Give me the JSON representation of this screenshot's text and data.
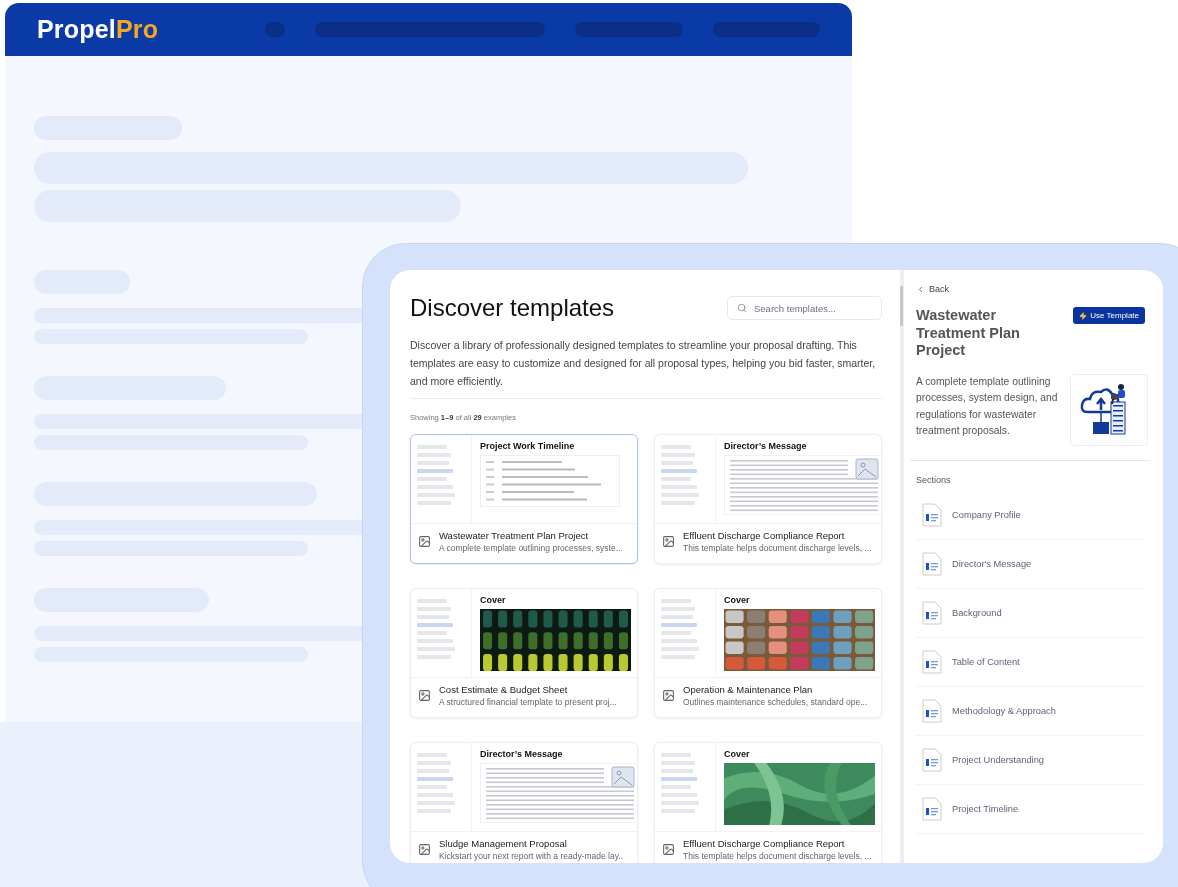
{
  "brand": {
    "first": "Propel",
    "second": "Pro"
  },
  "page": {
    "title": "Discover templates",
    "search": {
      "placeholder": "Search templates..."
    },
    "description": "Discover a library of professionally designed templates to streamline your proposal drafting. This templates are easy to customize and designed for all proposal types, helping you bid faster, smarter, and more efficiently.",
    "showing": "Showing **1–9** of all **29** examples"
  },
  "templates": [
    {
      "title": "Wastewater Treatment Plan Project",
      "description": "A complete template outlining processes, syste...",
      "selected": true,
      "preview": {
        "kind": "table",
        "heading": "Project Work Timeline"
      }
    },
    {
      "title": "Effluent Discharge Compliance Report",
      "description": "This template helps document discharge levels, ...",
      "selected": false,
      "preview": {
        "kind": "letter",
        "heading": "Director’s Message"
      }
    },
    {
      "title": "Cost Estimate & Budget Sheet",
      "description": "A structured financial template to present proj...",
      "selected": false,
      "preview": {
        "kind": "cover",
        "heading": "Cover"
      }
    },
    {
      "title": "Operation & Maintenance Plan",
      "description": "Outlines maintenance schedules, standard ope...",
      "selected": false,
      "preview": {
        "kind": "cover",
        "heading": "Cover"
      }
    },
    {
      "title": "Sludge Management Proposal",
      "description": "Kickstart your next report with a ready-made lay..",
      "selected": false,
      "preview": {
        "kind": "letter",
        "heading": "Director’s Message"
      }
    },
    {
      "title": "Effluent Discharge Compliance Report",
      "description": "This template helps document discharge levels, ...",
      "selected": false,
      "preview": {
        "kind": "cover",
        "heading": "Cover"
      }
    }
  ],
  "detail": {
    "back": "Back",
    "title": "Wastewater Treatment Plan Project",
    "button": "Use Template",
    "description": "A complete template outlining processes, system design, and regulations for wastewater treatment proposals.",
    "sections_label": "Sections",
    "sections": [
      "Company Profile",
      "Director's Message",
      "Background",
      "Table of Content",
      "Methodology & Approach",
      "Project Understanding",
      "Project Timeline"
    ]
  }
}
